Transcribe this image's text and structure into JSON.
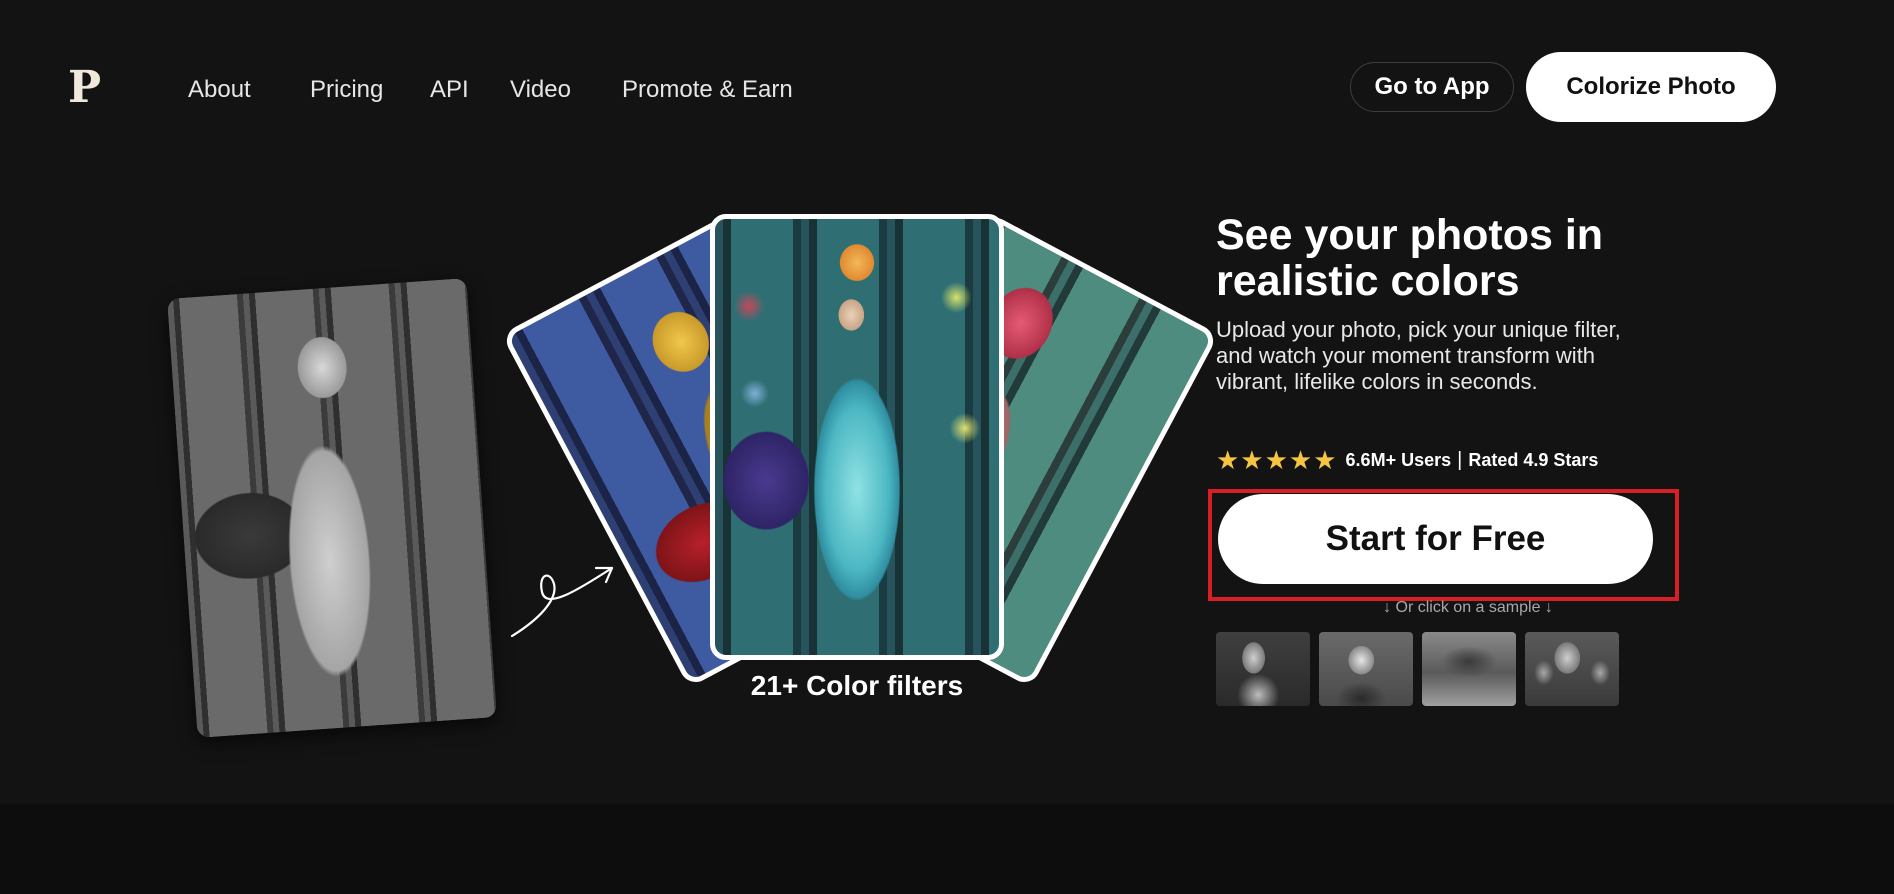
{
  "header": {
    "logo": "P",
    "nav": [
      "About",
      "Pricing",
      "API",
      "Video",
      "Promote & Earn"
    ],
    "go_to_app": "Go to App",
    "colorize_photo": "Colorize Photo"
  },
  "showcase": {
    "filters_label": "21+ Color filters"
  },
  "hero": {
    "headline": "See your photos in realistic colors",
    "subtext": "Upload your photo, pick your unique filter, and watch your moment transform with vibrant, lifelike colors in seconds.",
    "stars": "★★★★★",
    "users": "6.6M+ Users",
    "separator": "|",
    "rating": "Rated 4.9 Stars",
    "cta": "Start for Free",
    "sample_hint": "↓ Or click on a sample ↓"
  },
  "colors": {
    "background": "#131313",
    "cta_highlight": "#d81f26",
    "star": "#f5c542"
  }
}
